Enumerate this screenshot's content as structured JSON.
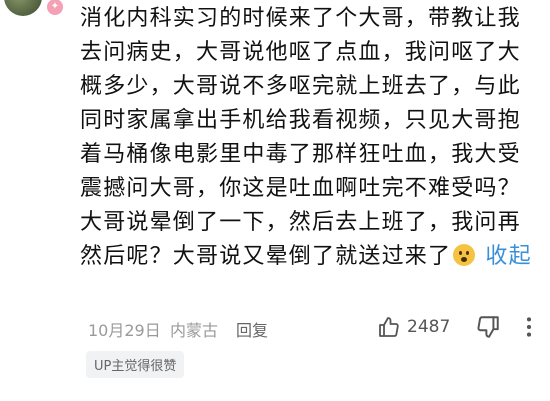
{
  "comment": {
    "text": "消化内科实习的时候来了个大哥，带教让我去问病史，大哥说他呕了点血，我问呕了大概多少，大哥说不多呕完就上班去了，与此同时家属拿出手机给我看视频，只见大哥抱着马桶像电影里中毒了那样狂吐血，我大受震撼问大哥，你这是吐血啊吐完不难受吗？大哥说晕倒了一下，然后去上班了，我问再然后呢？大哥说又晕倒了就送过来了",
    "emoji": "surprised-face-emoji",
    "collapse_label": "收起"
  },
  "meta": {
    "date": "10月29日",
    "location": "内蒙古",
    "reply_label": "回复",
    "like_count": "2487"
  },
  "tag": {
    "label": "UP主觉得很赞"
  },
  "colors": {
    "text": "#111111",
    "link": "#3a8fd8",
    "meta": "#9a9a9a",
    "tag_bg": "#f1f2f3"
  },
  "icons": {
    "like": "thumbs-up-icon",
    "dislike": "thumbs-down-icon",
    "more": "more-vertical-icon"
  }
}
